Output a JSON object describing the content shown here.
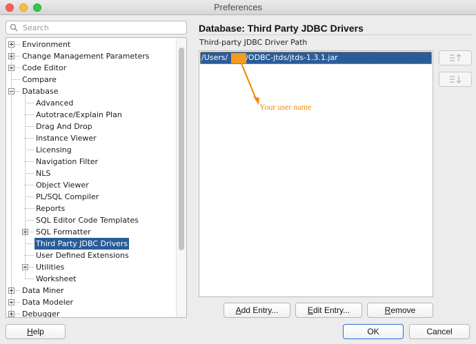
{
  "window": {
    "title": "Preferences"
  },
  "search": {
    "placeholder": "Search",
    "value": ""
  },
  "tree": {
    "items": [
      {
        "label": "Environment",
        "level": 0,
        "toggle": "plus"
      },
      {
        "label": "Change Management Parameters",
        "level": 0,
        "toggle": "plus"
      },
      {
        "label": "Code Editor",
        "level": 0,
        "toggle": "plus"
      },
      {
        "label": "Compare",
        "level": 0,
        "toggle": "none"
      },
      {
        "label": "Database",
        "level": 0,
        "toggle": "minus"
      },
      {
        "label": "Advanced",
        "level": 1,
        "toggle": "none"
      },
      {
        "label": "Autotrace/Explain Plan",
        "level": 1,
        "toggle": "none"
      },
      {
        "label": "Drag And Drop",
        "level": 1,
        "toggle": "none"
      },
      {
        "label": "Instance Viewer",
        "level": 1,
        "toggle": "none"
      },
      {
        "label": "Licensing",
        "level": 1,
        "toggle": "none"
      },
      {
        "label": "Navigation Filter",
        "level": 1,
        "toggle": "none"
      },
      {
        "label": "NLS",
        "level": 1,
        "toggle": "none"
      },
      {
        "label": "Object Viewer",
        "level": 1,
        "toggle": "none"
      },
      {
        "label": "PL/SQL Compiler",
        "level": 1,
        "toggle": "none"
      },
      {
        "label": "Reports",
        "level": 1,
        "toggle": "none"
      },
      {
        "label": "SQL Editor Code Templates",
        "level": 1,
        "toggle": "none"
      },
      {
        "label": "SQL Formatter",
        "level": 1,
        "toggle": "plus"
      },
      {
        "label": "Third Party JDBC Drivers",
        "level": 1,
        "toggle": "none",
        "selected": true
      },
      {
        "label": "User Defined Extensions",
        "level": 1,
        "toggle": "none"
      },
      {
        "label": "Utilities",
        "level": 1,
        "toggle": "plus"
      },
      {
        "label": "Worksheet",
        "level": 1,
        "toggle": "none"
      },
      {
        "label": "Data Miner",
        "level": 0,
        "toggle": "plus"
      },
      {
        "label": "Data Modeler",
        "level": 0,
        "toggle": "plus"
      },
      {
        "label": "Debugger",
        "level": 0,
        "toggle": "plus"
      }
    ]
  },
  "main": {
    "title": "Database: Third Party JDBC Drivers",
    "section_label": "Third-party JDBC Driver Path",
    "paths": [
      {
        "prefix": "/Users/",
        "suffix": "/ODBC-jtds/jtds-1.3.1.jar",
        "selected": true
      }
    ],
    "annotation": "Your user name",
    "move_up_icon": "move-up-icon",
    "move_down_icon": "move-down-icon"
  },
  "buttons": {
    "add_entry": {
      "mnemonic": "A",
      "rest": "dd Entry..."
    },
    "edit_entry": {
      "mnemonic": "E",
      "rest": "dit Entry..."
    },
    "remove": {
      "mnemonic": "R",
      "rest": "emove"
    },
    "help": {
      "mnemonic": "H",
      "rest": "elp"
    },
    "ok": "OK",
    "cancel": "Cancel"
  },
  "colors": {
    "selection": "#2a5c99",
    "annotation": "#f08a0e",
    "redaction": "#f39c1e"
  }
}
